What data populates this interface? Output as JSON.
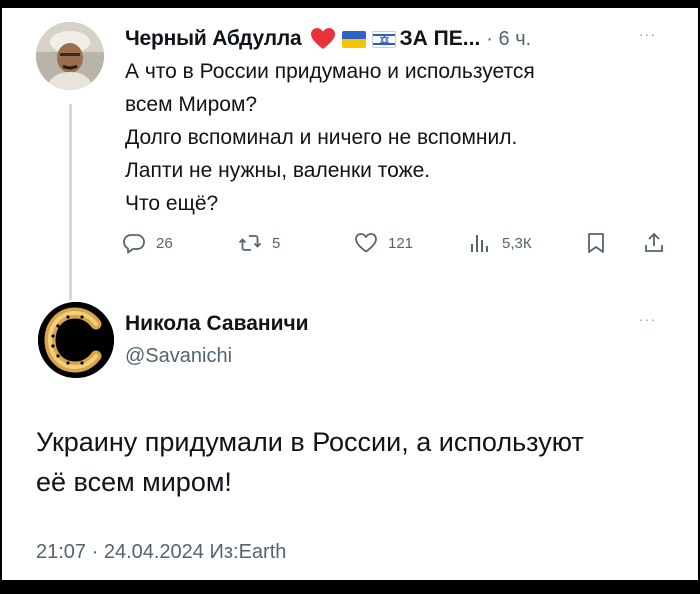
{
  "colors": {
    "background": "#ffffff",
    "frame": "#000000",
    "text": "#0f1419",
    "secondary": "#536471",
    "thread_line": "#cfd9de",
    "heart": "#e8333c",
    "flag_ua_blue": "#2e63c8",
    "flag_ua_yellow": "#f5c400",
    "flag_il_blue": "#2a5bd0"
  },
  "tweet1": {
    "author_name": "Черный Абдулла",
    "name_tail": "ЗА ПЕ...",
    "separator": "·",
    "time": "6 ч.",
    "more": "···",
    "badges": [
      "heart-icon",
      "ukraine-flag-icon",
      "israel-flag-icon"
    ],
    "lines": [
      "А что в России придумано и используется",
      "всем Миром?",
      "Долго вспоминал и ничего не вспомнил.",
      "Лапти не нужны, валенки тоже.",
      "Что ещё?"
    ],
    "actions": {
      "replies": "26",
      "reposts": "5",
      "likes": "121",
      "views": "5,3К"
    }
  },
  "tweet2": {
    "author_name": "Никола Саваничи",
    "handle": "@Savanichi",
    "more": "···",
    "lines": [
      "Украину придумали в России, а используют",
      "её всем миром!"
    ],
    "meta": "21:07 · 24.04.2024 Из:Earth"
  }
}
